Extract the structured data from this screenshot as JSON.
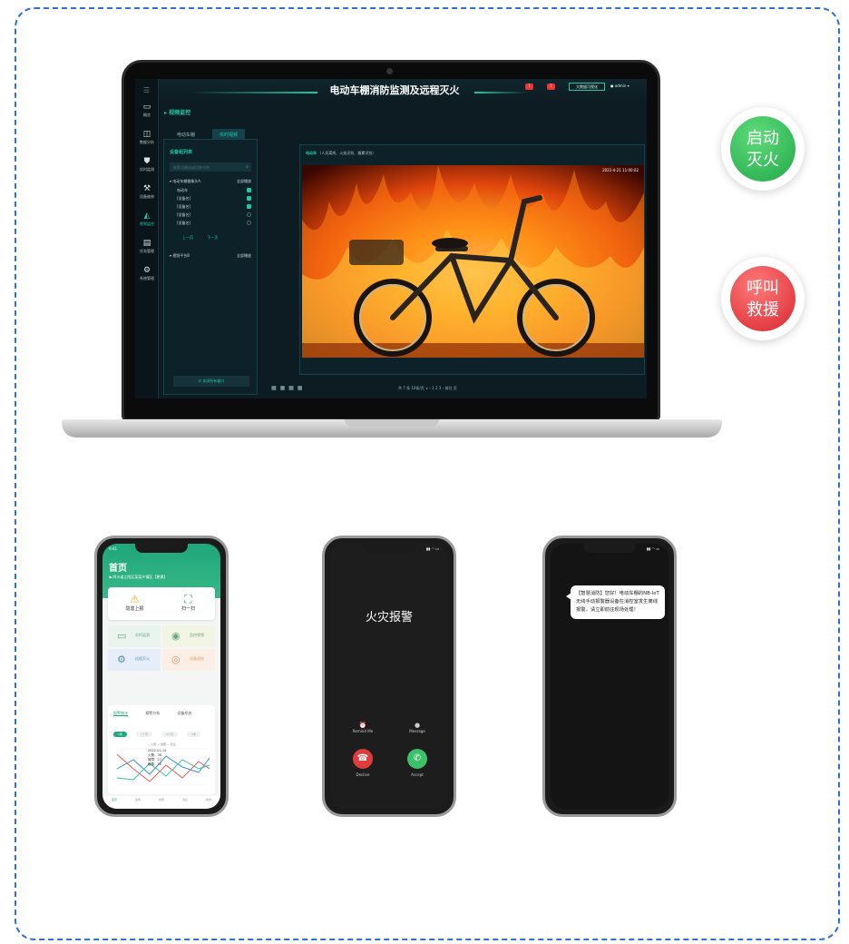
{
  "laptop": {
    "app_title": "电动车棚消防监测及远程灭火",
    "menu_icon": "menu-icon",
    "sidebar": [
      {
        "label": "概览",
        "icon": "monitor-icon",
        "active": false
      },
      {
        "label": "数据分析",
        "icon": "chart-icon",
        "active": false
      },
      {
        "label": "实时监测",
        "icon": "shield-icon",
        "active": false
      },
      {
        "label": "设备维修",
        "icon": "wrench-icon",
        "active": false
      },
      {
        "label": "视频监控",
        "icon": "camera-icon",
        "active": true
      },
      {
        "label": "任务管理",
        "icon": "task-icon",
        "active": false
      },
      {
        "label": "系统管理",
        "icon": "settings-icon",
        "active": false
      }
    ],
    "topbar": {
      "badge1": "1",
      "badge2": "1",
      "big_screen": "大数据可视化",
      "user": "admin"
    },
    "breadcrumb": "视频监控",
    "tabs": [
      "电动车棚",
      "实时视频"
    ],
    "device_list": {
      "title": "设备组列表",
      "search_placeholder": "搜索设备组或设备名称",
      "group1": {
        "name": "电动车棚摄像头A",
        "action": "全部播放"
      },
      "devices": [
        {
          "name": "电动车",
          "checked": true
        },
        {
          "name": "[设备名]",
          "checked": true
        },
        {
          "name": "[设备名]",
          "checked": true
        },
        {
          "name": "[设备名]",
          "checked": false
        },
        {
          "name": "[设备名]",
          "checked": false
        }
      ],
      "prev": "上一页",
      "next": "下一页",
      "group2": {
        "name": "视频平台B",
        "action": "全部播放"
      },
      "close_all": "关闭所有窗口"
    },
    "video": {
      "title": "电动车",
      "tags": "（人员离岗、火焰识别、烟雾识别）",
      "timestamp": "2022-4-21 11:00:02"
    },
    "pagination": {
      "views": "▦ ▦ ▦ ▦",
      "text": "共 7 条    10条/页 ∨    ‹  1  2  3  ›    前往        页"
    }
  },
  "buttons": {
    "start": "启动\n灭火",
    "start_line1": "启动",
    "start_line2": "灭火",
    "call_line1": "呼叫",
    "call_line2": "救援"
  },
  "phone1": {
    "status_time": "9:41",
    "title": "首页",
    "location": "四川省江阳区某某乡镇区【更换】",
    "actions": [
      "隐患上报",
      "扫一扫"
    ],
    "tiles": [
      "实时监测",
      "监控视频",
      "远程灭火",
      "设备巡检"
    ],
    "stats_tabs": [
      "报警统计",
      "报警分析",
      "设备状态"
    ],
    "pills": [
      "1周",
      "1个月",
      "6个月",
      "1年"
    ],
    "legend": "— 火警 — 故障 — 隐患",
    "tooltip": [
      "2022-01-14",
      "火警：36",
      "故障：27",
      "隐患：16"
    ],
    "tabbar": [
      "首页",
      "监测",
      "告警",
      "消息",
      "我的"
    ]
  },
  "phone2": {
    "title": "火灾报警",
    "remind": "Remind Me",
    "message": "Message",
    "decline": "Decline",
    "accept": "Accept",
    "colors": {
      "decline": "#e23b3b",
      "accept": "#3cc168"
    }
  },
  "phone3": {
    "sms": "【智慧消防】您好！电动车棚的NB-IoT无线手动报警器设备在消控室发生离线报警，请立即前往现场处理！"
  }
}
